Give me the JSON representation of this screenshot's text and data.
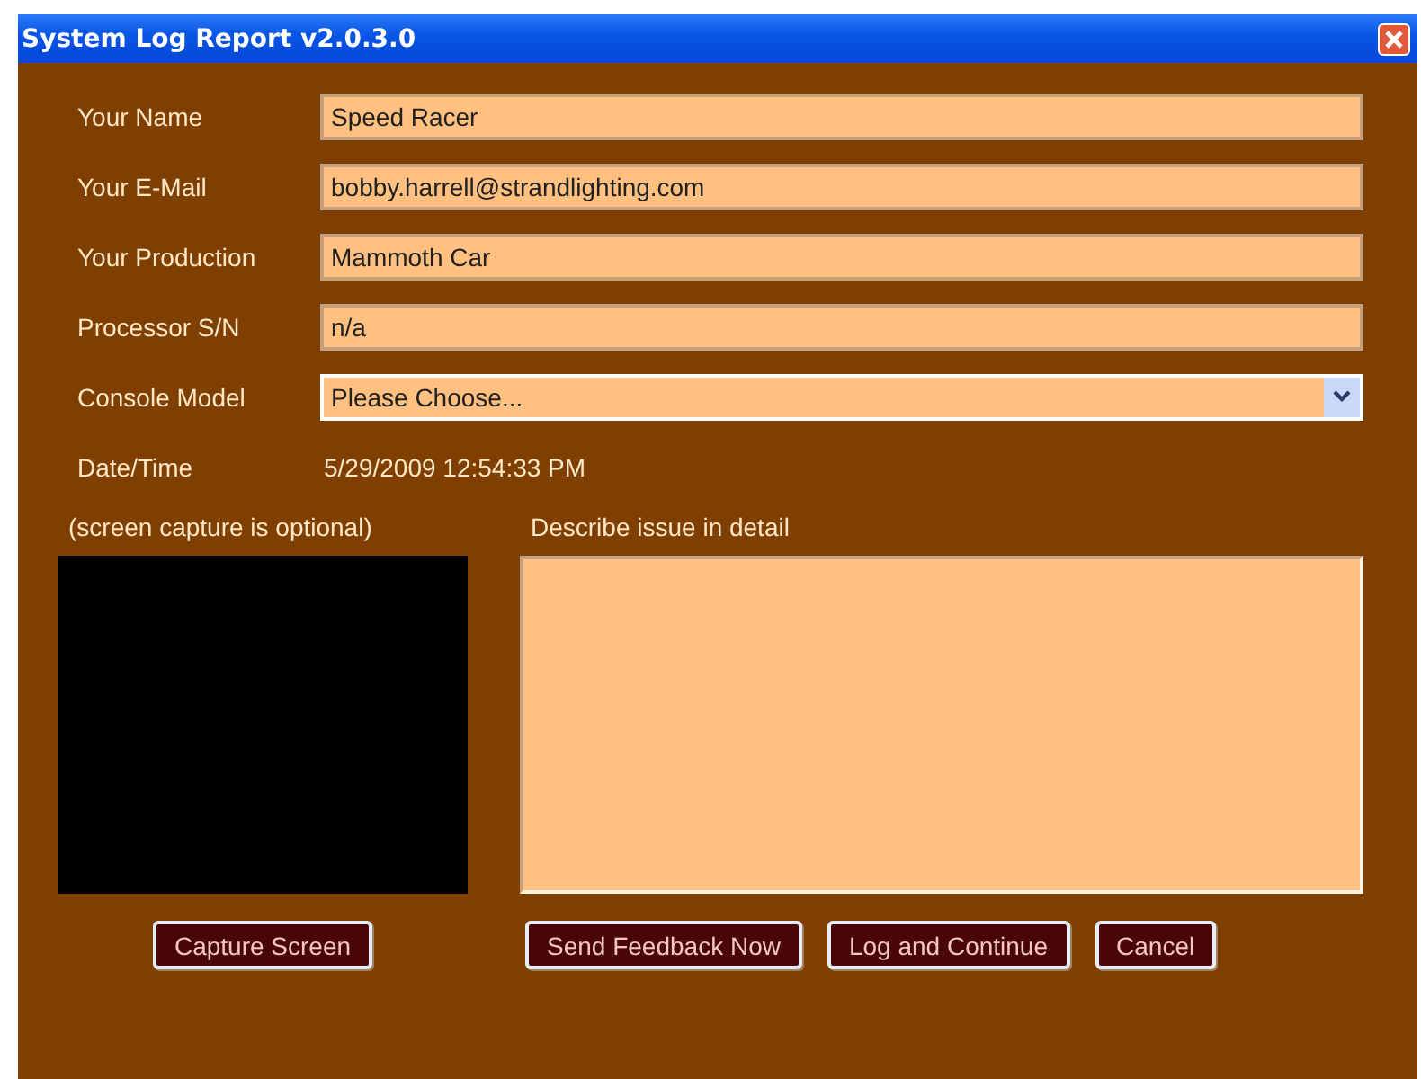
{
  "window": {
    "title": "System Log Report v2.0.3.0"
  },
  "fields": [
    {
      "label": "Your Name",
      "kind": "text",
      "value": "Speed Racer"
    },
    {
      "label": "Your E-Mail",
      "kind": "text",
      "value": "bobby.harrell@strandlighting.com"
    },
    {
      "label": "Your Production",
      "kind": "text",
      "value": "Mammoth Car"
    },
    {
      "label": "Processor S/N",
      "kind": "text",
      "value": "n/a"
    },
    {
      "label": "Console Model",
      "kind": "select",
      "value": "Please Choose..."
    },
    {
      "label": "Date/Time",
      "kind": "static",
      "value": "5/29/2009 12:54:33 PM"
    }
  ],
  "capture": {
    "caption": "(screen capture is optional)",
    "button": "Capture Screen"
  },
  "details": {
    "caption": "Describe issue in detail"
  },
  "buttons": [
    "Send Feedback Now",
    "Log and Continue",
    "Cancel"
  ]
}
